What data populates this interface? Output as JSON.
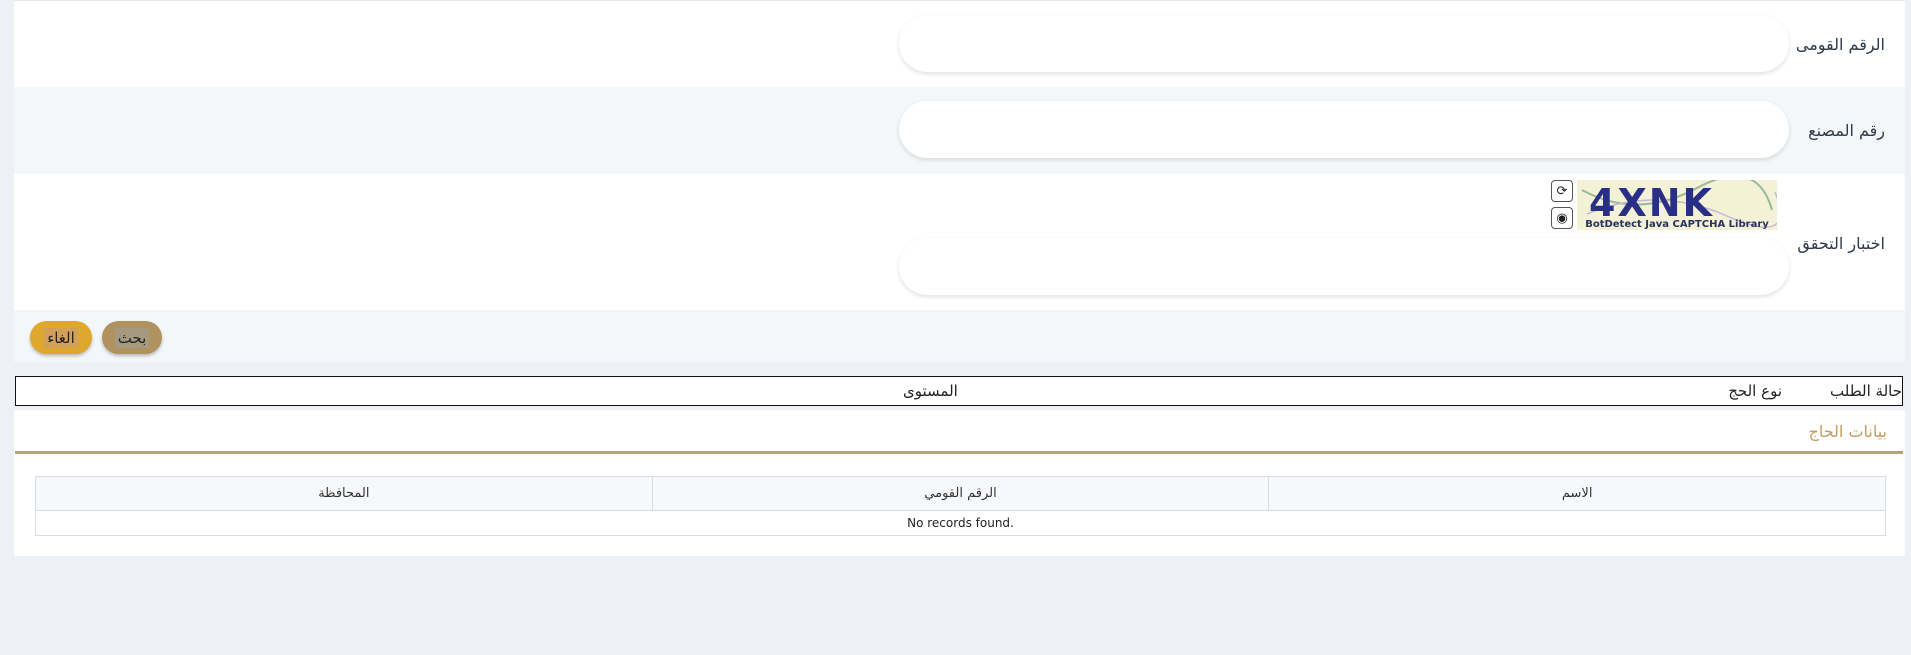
{
  "form": {
    "national_id_label": "الرقم القومى",
    "factory_number_label": "رقم المصنع",
    "captcha_label": "اختبار التحقق",
    "captcha_text": "4XNK",
    "captcha_caption": "BotDetect Java CAPTCHA Library",
    "search_button": "بحث",
    "cancel_button": "الغاء"
  },
  "filters": {
    "request_status": "حالة الطلب",
    "hajj_type": "نوع الحج",
    "level": "المستوى"
  },
  "section": {
    "title": "بيانات الحاج"
  },
  "table": {
    "columns": [
      "الاسم",
      "الرقم القومي",
      "المحافظة"
    ],
    "empty_message": "No records found."
  },
  "colors": {
    "search_button": "#b0925e",
    "cancel_button": "#e0a72e",
    "section_title": "#c59b62",
    "gold_line": "#b5a27a"
  }
}
